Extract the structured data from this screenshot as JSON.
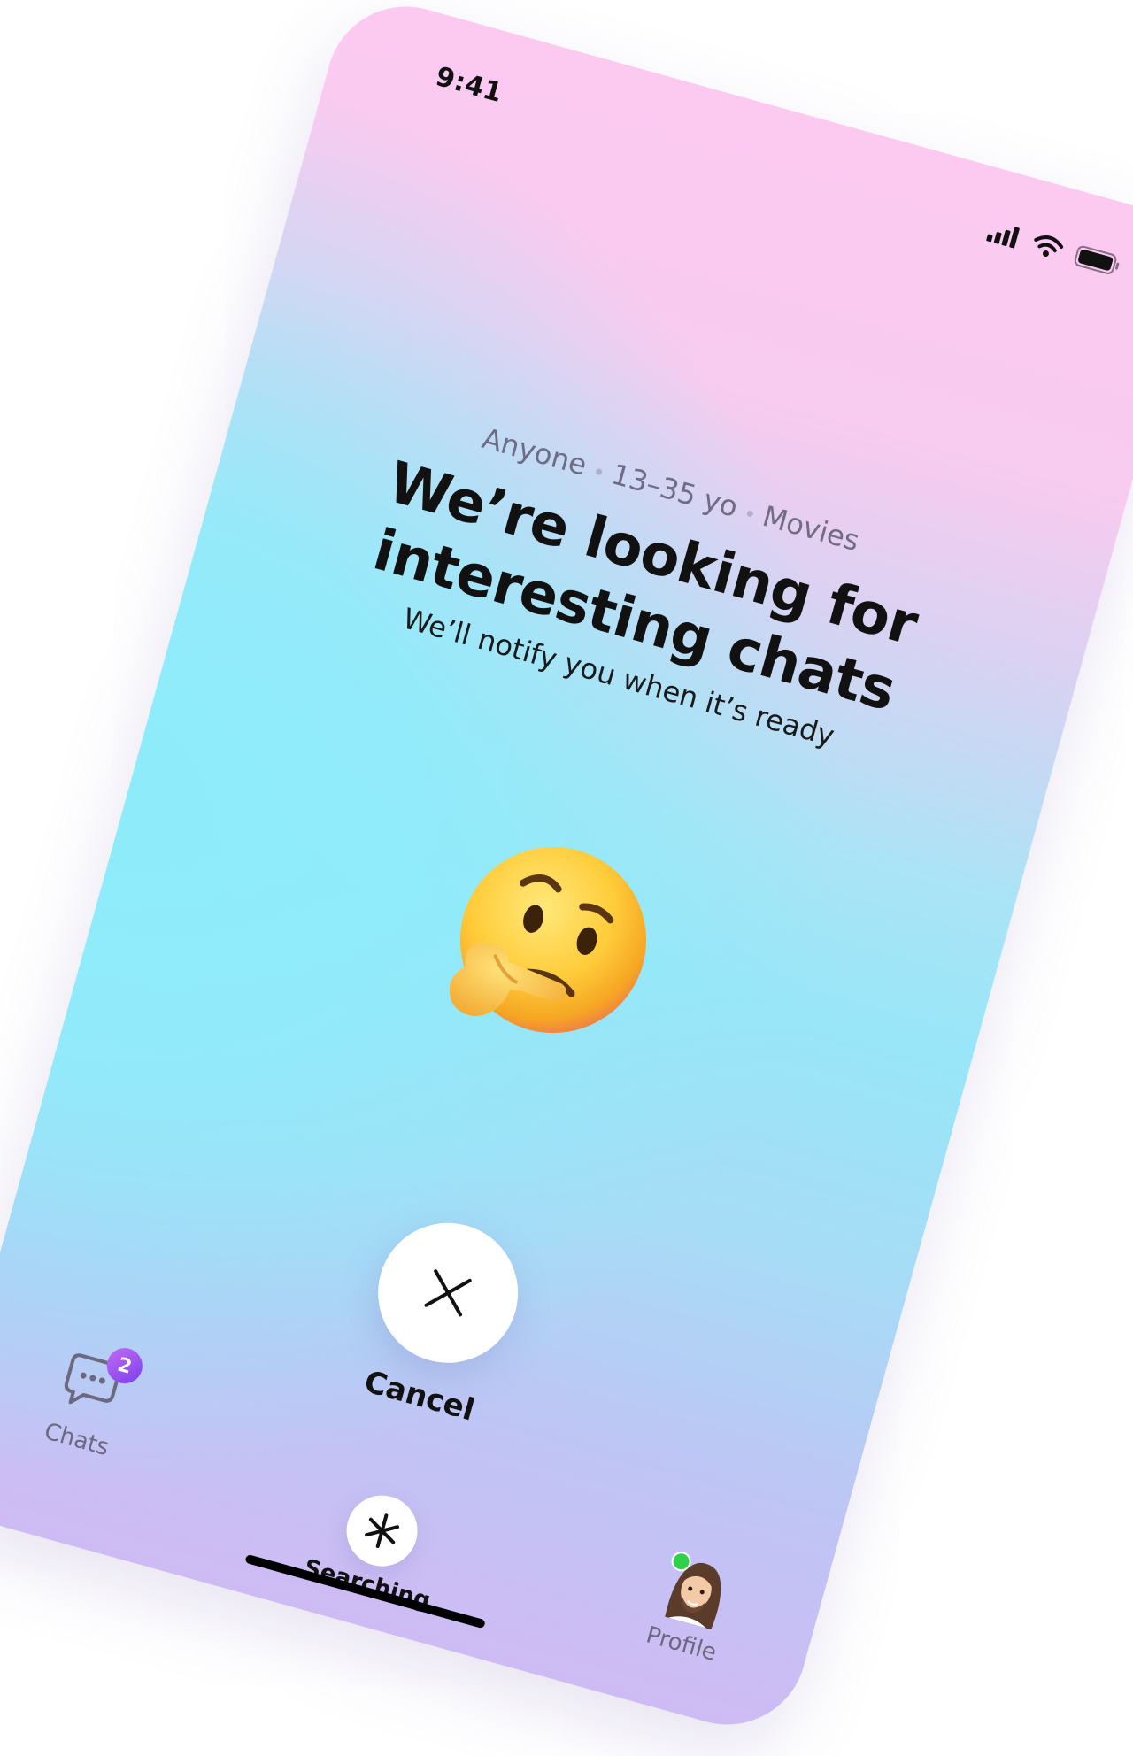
{
  "status_bar": {
    "time": "9:41",
    "signal_icon": "cellular-signal-icon",
    "wifi_icon": "wifi-icon",
    "battery_icon": "battery-icon"
  },
  "search": {
    "filters": [
      "Anyone",
      "13–35 yo",
      "Movies"
    ],
    "headline_line1": "We’re looking for",
    "headline_line2": "interesting chats",
    "subtitle": "We’ll notify you when it’s ready",
    "emoji": "thinking-face-emoji"
  },
  "cancel": {
    "icon": "close-icon",
    "label": "Cancel"
  },
  "tabbar": {
    "chats": {
      "label": "Chats",
      "icon": "chat-bubble-icon",
      "badge": "2"
    },
    "searching": {
      "label": "Searching",
      "icon": "asterisk-icon"
    },
    "profile": {
      "label": "Profile",
      "icon": "avatar",
      "online": true
    }
  },
  "colors": {
    "gradient_top": "#fcc9f1",
    "gradient_middle": "#98e6f8",
    "gradient_bottom": "#cfbbf4",
    "badge": "#a052f0",
    "online": "#2fd14a"
  }
}
